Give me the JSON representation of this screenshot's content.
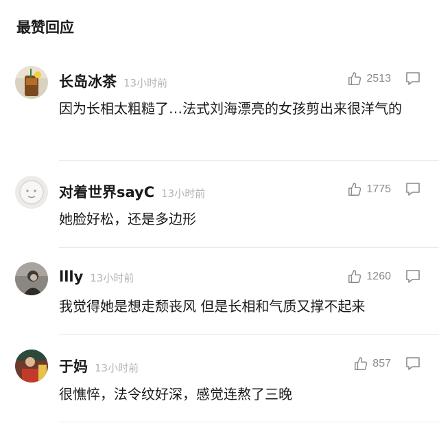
{
  "section": {
    "title": "最赞回应"
  },
  "comments": [
    {
      "username": "长岛冰茶",
      "time": "13小时前",
      "likes": "2513",
      "text": "因为长相太粗糙了…法式刘海漂亮的女孩剪出来很洋气的"
    },
    {
      "username": "对着世界sayC",
      "time": "13小时前",
      "likes": "1775",
      "text": "她脸好松，还是多边形"
    },
    {
      "username": "llly",
      "time": "13小时前",
      "likes": "1260",
      "text": "我觉得她是想走颓丧风 但是长相和气质又撑不起来"
    },
    {
      "username": "于妈",
      "time": "13小时前",
      "likes": "857",
      "text": "很憔悴，法令纹好深，感觉连熬了三晚"
    }
  ],
  "icons": {
    "like": "thumbs-up-icon",
    "reply": "comment-bubble-icon"
  },
  "colors": {
    "text": "#1a1a1a",
    "meta": "#b4b4b4",
    "count": "#8a8a8a",
    "divider": "#e9e9e9"
  }
}
